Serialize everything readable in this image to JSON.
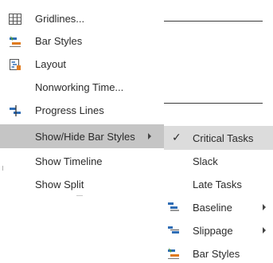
{
  "menu": {
    "items": [
      {
        "id": "gridlines",
        "label": "Gridlines...",
        "icon": "gridlines-icon"
      },
      {
        "id": "bar-styles",
        "label": "Bar Styles",
        "icon": "bar-styles-icon"
      },
      {
        "id": "layout",
        "label": "Layout",
        "icon": "layout-icon"
      },
      {
        "id": "nonworking-time",
        "label": "Nonworking Time...",
        "icon": ""
      },
      {
        "id": "progress-lines",
        "label": "Progress Lines",
        "icon": "progress-lines-icon"
      },
      {
        "id": "show-hide-bar-styles",
        "label": "Show/Hide Bar Styles",
        "icon": ""
      },
      {
        "id": "show-timeline",
        "label": "Show Timeline",
        "icon": ""
      },
      {
        "id": "show-split",
        "label": "Show Split",
        "icon": ""
      }
    ]
  },
  "submenu": {
    "items": [
      {
        "id": "critical-tasks",
        "label": "Critical Tasks",
        "checked": true
      },
      {
        "id": "slack",
        "label": "Slack"
      },
      {
        "id": "late-tasks",
        "label": "Late Tasks"
      },
      {
        "id": "baseline",
        "label": "Baseline",
        "icon": "baseline-icon",
        "has_submenu": true
      },
      {
        "id": "slippage",
        "label": "Slippage",
        "icon": "slippage-icon",
        "has_submenu": true
      },
      {
        "id": "bar-styles-sub",
        "label": "Bar Styles",
        "icon": "bar-styles-icon"
      }
    ]
  },
  "colors": {
    "highlight": "#c5c5c5",
    "submenu_highlight": "#dcdcdc",
    "icon_blue": "#2f6db5",
    "icon_orange": "#e07b1f",
    "icon_green": "#4f9a3e"
  }
}
